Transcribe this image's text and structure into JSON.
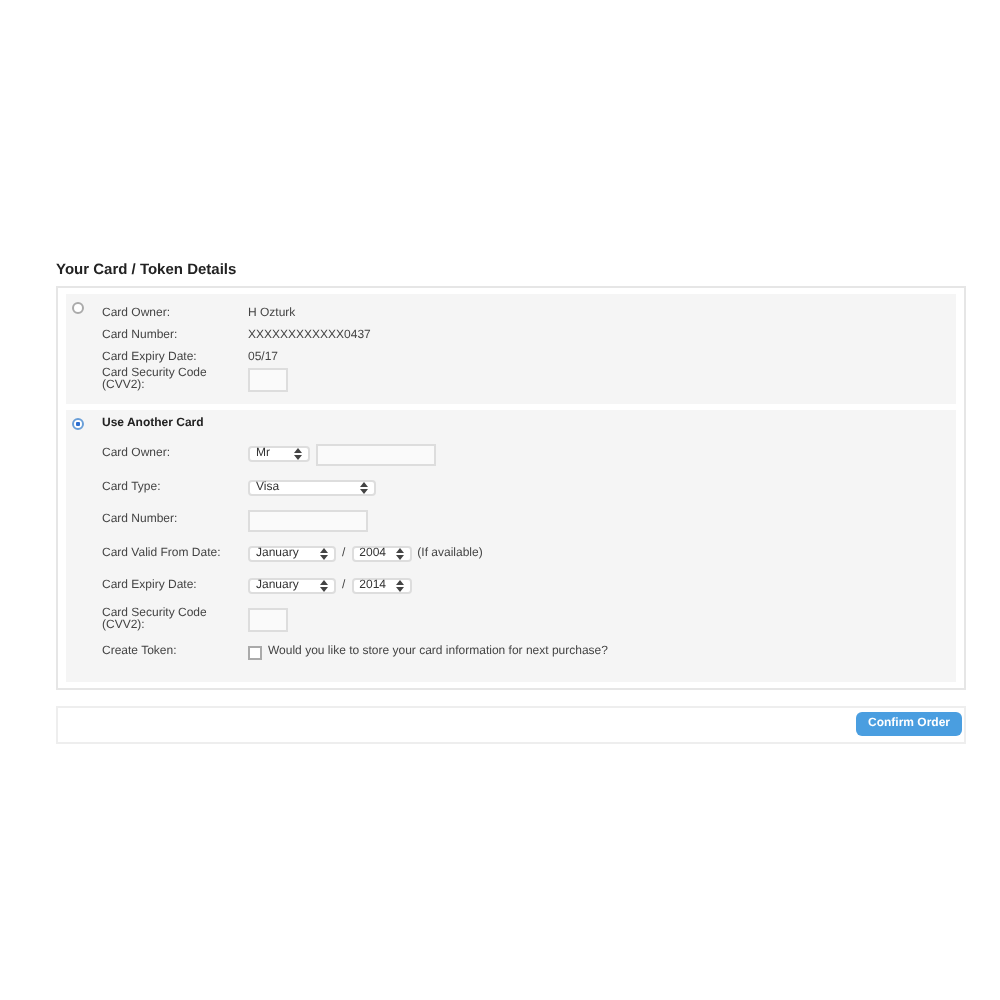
{
  "heading": "Your Card / Token Details",
  "saved_card": {
    "selected": false,
    "rows": [
      {
        "kind": "text",
        "label": "Card Owner:",
        "value": "H Ozturk"
      },
      {
        "kind": "text",
        "label": "Card Number:",
        "value": "XXXXXXXXXXXX0437"
      },
      {
        "kind": "text",
        "label": "Card Expiry Date:",
        "value": "05/17"
      },
      {
        "kind": "cvv",
        "label": "Card Security Code (CVV2):"
      }
    ]
  },
  "new_card": {
    "selected": true,
    "title": "Use Another Card",
    "rows": [
      {
        "kind": "owner",
        "label": "Card Owner:",
        "title_select": "Mr"
      },
      {
        "kind": "select",
        "label": "Card Type:",
        "select": "Visa"
      },
      {
        "kind": "input",
        "label": "Card Number:"
      },
      {
        "kind": "date",
        "label": "Card Valid From Date:",
        "month": "January",
        "sep": "/",
        "year": "2004",
        "note": "(If available)"
      },
      {
        "kind": "date",
        "label": "Card Expiry Date:",
        "month": "January",
        "sep": "/",
        "year": "2014"
      },
      {
        "kind": "cvv",
        "label": "Card Security Code (CVV2):"
      },
      {
        "kind": "check",
        "label": "Create Token:",
        "checked": false,
        "text": "Would you like to store your card information for next purchase?"
      }
    ]
  },
  "confirm_button": "Confirm Order"
}
